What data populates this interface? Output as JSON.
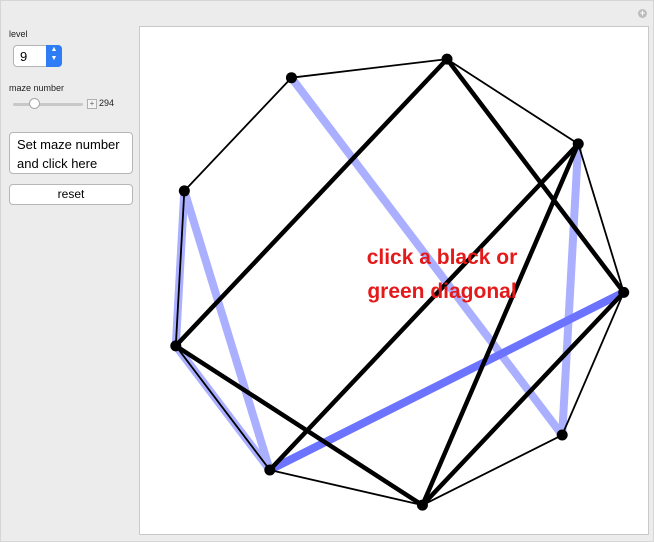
{
  "controls": {
    "level_label": "level",
    "level_value": "9",
    "maze_label": "maze number",
    "maze_value": "294",
    "maze_slider_fraction": 0.3,
    "set_button_line1": "Set maze number",
    "set_button_line2": "and click here",
    "reset_label": "reset"
  },
  "message": {
    "line1": "click a black or",
    "line2": "green diagonal"
  },
  "colors": {
    "message": "#e41a1a",
    "diagonal_dark": "#000000",
    "diagonal_light": "#aab0ff",
    "diagonal_active": "#6c74ff",
    "stepper": "#2e7df6"
  },
  "polygon": {
    "vertex_count": 9,
    "vertex_labels": [],
    "black_diagonals": [
      [
        1,
        3
      ],
      [
        1,
        7
      ],
      [
        2,
        5
      ],
      [
        2,
        6
      ],
      [
        3,
        5
      ],
      [
        7,
        5
      ]
    ],
    "blue_diagonals": [
      [
        0,
        4
      ],
      [
        2,
        4
      ],
      [
        7,
        6
      ],
      [
        7,
        8
      ],
      [
        6,
        8
      ]
    ],
    "active_diagonal": [
      3,
      6
    ]
  }
}
